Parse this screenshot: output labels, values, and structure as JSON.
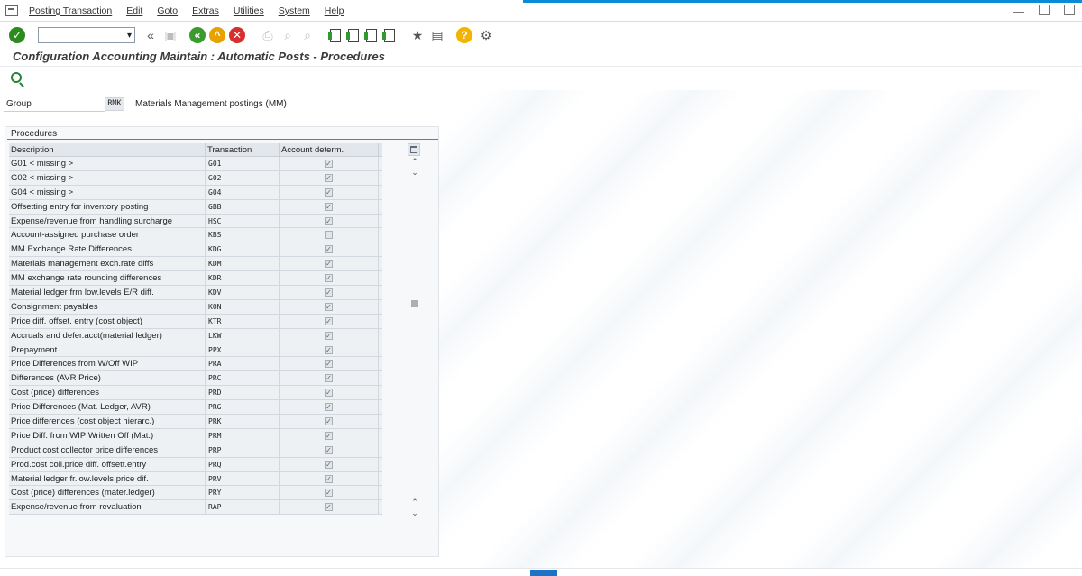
{
  "menu": [
    "Posting Transaction",
    "Edit",
    "Goto",
    "Extras",
    "Utilities",
    "System",
    "Help"
  ],
  "toolbar": {
    "command_field_value": "",
    "icons": [
      "enter-icon",
      "command-dropdown",
      "collapse-icon",
      "save-icon",
      "back-icon",
      "exit-icon",
      "cancel-icon",
      "print-icon",
      "find-icon",
      "find-next-icon",
      "first-page-icon",
      "previous-page-icon",
      "next-page-icon",
      "last-page-icon",
      "create-session-icon",
      "shortcut-icon",
      "help-icon",
      "customize-icon"
    ]
  },
  "title": "Configuration Accounting Maintain : Automatic Posts - Procedures",
  "group": {
    "label": "Group",
    "value": "RMK",
    "description": "Materials Management postings (MM)"
  },
  "procedures": {
    "section_title": "Procedures",
    "columns": [
      "Description",
      "Transaction",
      "Account determ."
    ],
    "rows": [
      {
        "description": "G01 < missing >",
        "transaction": "G01",
        "checked": true
      },
      {
        "description": "G02 < missing >",
        "transaction": "G02",
        "checked": true
      },
      {
        "description": "G04 < missing >",
        "transaction": "G04",
        "checked": true
      },
      {
        "description": "Offsetting entry for inventory posting",
        "transaction": "GBB",
        "checked": true
      },
      {
        "description": "Expense/revenue from handling surcharge",
        "transaction": "HSC",
        "checked": true
      },
      {
        "description": "Account-assigned purchase order",
        "transaction": "KBS",
        "checked": false
      },
      {
        "description": "MM Exchange Rate Differences",
        "transaction": "KDG",
        "checked": true
      },
      {
        "description": "Materials management exch.rate diffs",
        "transaction": "KDM",
        "checked": true
      },
      {
        "description": "MM exchange rate rounding differences",
        "transaction": "KDR",
        "checked": true
      },
      {
        "description": "Material ledger frm low.levels E/R diff.",
        "transaction": "KDV",
        "checked": true
      },
      {
        "description": "Consignment payables",
        "transaction": "KON",
        "checked": true
      },
      {
        "description": "Price diff. offset. entry (cost object)",
        "transaction": "KTR",
        "checked": true
      },
      {
        "description": "Accruals and defer.acct(material ledger)",
        "transaction": "LKW",
        "checked": true
      },
      {
        "description": "Prepayment",
        "transaction": "PPX",
        "checked": true
      },
      {
        "description": "Price Differences from W/Off WIP",
        "transaction": "PRA",
        "checked": true
      },
      {
        "description": "Differences (AVR Price)",
        "transaction": "PRC",
        "checked": true
      },
      {
        "description": "Cost (price) differences",
        "transaction": "PRD",
        "checked": true
      },
      {
        "description": "Price Differences (Mat. Ledger, AVR)",
        "transaction": "PRG",
        "checked": true
      },
      {
        "description": "Price differences (cost object hierarc.)",
        "transaction": "PRK",
        "checked": true
      },
      {
        "description": "Price Diff. from WIP Written Off (Mat.)",
        "transaction": "PRM",
        "checked": true
      },
      {
        "description": "Product cost collector price differences",
        "transaction": "PRP",
        "checked": true
      },
      {
        "description": "Prod.cost coll.price diff. offsett.entry",
        "transaction": "PRQ",
        "checked": true
      },
      {
        "description": "Material ledger fr.low.levels price dif.",
        "transaction": "PRV",
        "checked": true
      },
      {
        "description": "Cost (price) differences (mater.ledger)",
        "transaction": "PRY",
        "checked": true
      },
      {
        "description": "Expense/revenue from revaluation",
        "transaction": "RAP",
        "checked": true
      }
    ]
  },
  "colors": {
    "accent": "#0a8bd6",
    "ok": "#2c8a1e",
    "cancel": "#d62f2f",
    "exit": "#e8a200"
  }
}
